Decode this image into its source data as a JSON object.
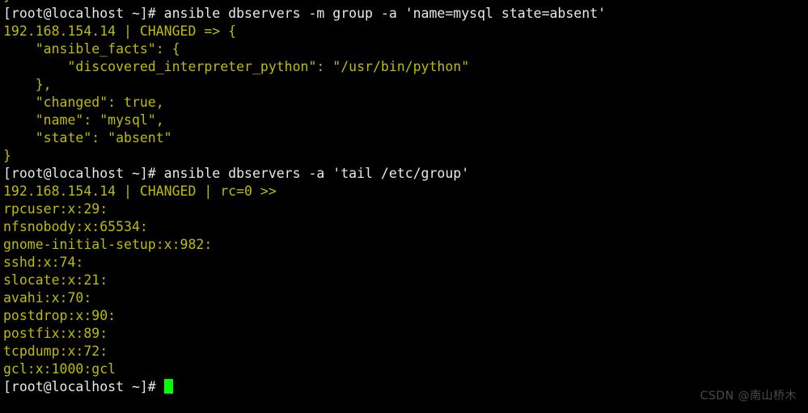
{
  "terminal": {
    "background_color": "#000000",
    "prompt_color": "#e8e8e8",
    "output_color": "#bdbd00",
    "cursor_color": "#00ff00",
    "partial_top_line": "}",
    "lines": [
      {
        "id": "cmd-1",
        "type": "command",
        "color": "white",
        "text": "[root@localhost ~]# ansible dbservers -m group -a 'name=mysql state=absent'"
      },
      {
        "id": "out-1",
        "type": "output",
        "color": "yellow",
        "text": "192.168.154.14 | CHANGED => {"
      },
      {
        "id": "out-2",
        "type": "output",
        "color": "yellow",
        "text": "    \"ansible_facts\": {"
      },
      {
        "id": "out-3",
        "type": "output",
        "color": "yellow",
        "text": "        \"discovered_interpreter_python\": \"/usr/bin/python\""
      },
      {
        "id": "out-4",
        "type": "output",
        "color": "yellow",
        "text": "    },"
      },
      {
        "id": "out-5",
        "type": "output",
        "color": "yellow",
        "text": "    \"changed\": true,"
      },
      {
        "id": "out-6",
        "type": "output",
        "color": "yellow",
        "text": "    \"name\": \"mysql\","
      },
      {
        "id": "out-7",
        "type": "output",
        "color": "yellow",
        "text": "    \"state\": \"absent\""
      },
      {
        "id": "out-8",
        "type": "output",
        "color": "yellow",
        "text": "}"
      },
      {
        "id": "cmd-2",
        "type": "command",
        "color": "white",
        "text": "[root@localhost ~]# ansible dbservers -a 'tail /etc/group'"
      },
      {
        "id": "out-9",
        "type": "output",
        "color": "yellow",
        "text": "192.168.154.14 | CHANGED | rc=0 >>"
      },
      {
        "id": "grp-rpcuser",
        "type": "output",
        "color": "yellow",
        "text": "rpcuser:x:29:"
      },
      {
        "id": "grp-nfsnobody",
        "type": "output",
        "color": "yellow",
        "text": "nfsnobody:x:65534:"
      },
      {
        "id": "grp-gnome",
        "type": "output",
        "color": "yellow",
        "text": "gnome-initial-setup:x:982:"
      },
      {
        "id": "grp-sshd",
        "type": "output",
        "color": "yellow",
        "text": "sshd:x:74:"
      },
      {
        "id": "grp-slocate",
        "type": "output",
        "color": "yellow",
        "text": "slocate:x:21:"
      },
      {
        "id": "grp-avahi",
        "type": "output",
        "color": "yellow",
        "text": "avahi:x:70:"
      },
      {
        "id": "grp-postdrop",
        "type": "output",
        "color": "yellow",
        "text": "postdrop:x:90:"
      },
      {
        "id": "grp-postfix",
        "type": "output",
        "color": "yellow",
        "text": "postfix:x:89:"
      },
      {
        "id": "grp-tcpdump",
        "type": "output",
        "color": "yellow",
        "text": "tcpdump:x:72:"
      },
      {
        "id": "grp-gcl",
        "type": "output",
        "color": "yellow",
        "text": "gcl:x:1000:gcl"
      }
    ],
    "final_prompt": "[root@localhost ~]# "
  },
  "watermark": {
    "text": "CSDN @南山桥木"
  }
}
